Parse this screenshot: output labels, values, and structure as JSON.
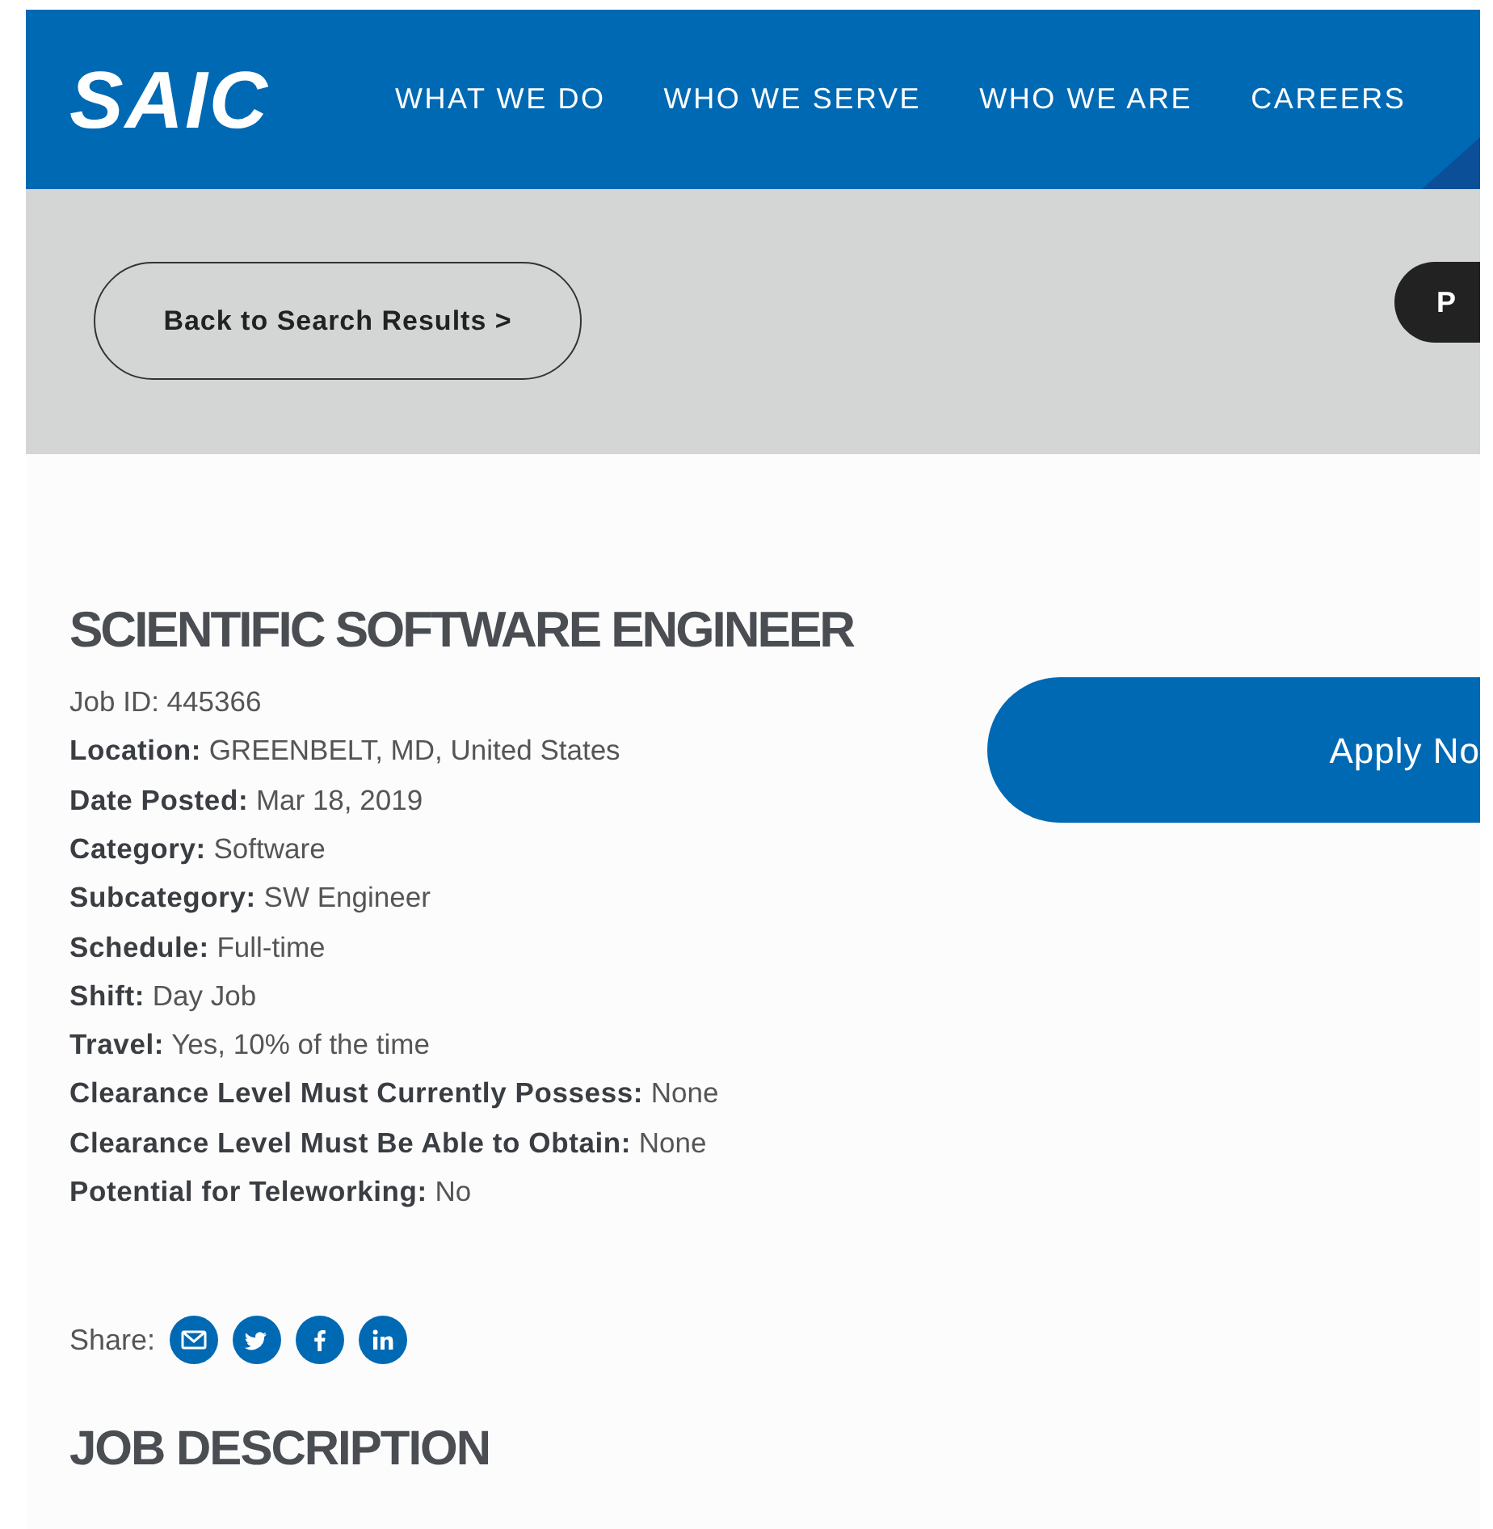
{
  "header": {
    "logo": "SAIC",
    "nav": [
      {
        "label": "WHAT WE DO"
      },
      {
        "label": "WHO WE SERVE"
      },
      {
        "label": "WHO WE ARE"
      },
      {
        "label": "CAREERS"
      }
    ]
  },
  "toolbar": {
    "back_button": "Back to Search Results >",
    "dark_button": "P"
  },
  "job": {
    "title": "SCIENTIFIC SOFTWARE ENGINEER",
    "details": [
      "Job ID: 445366",
      "**Location:** GREENBELT, MD, United States",
      "**Date Posted:** Mar 18, 2019",
      "**Category:** Software",
      "**Subcategory:** SW Engineer",
      "**Schedule:** Full-time",
      "**Shift:** Day Job",
      "**Travel:** Yes, 10% of the time",
      "**Clearance Level Must Currently Possess:** None",
      "**Clearance Level Must Be Able to Obtain:** None",
      "**Potential for Teleworking:** No"
    ],
    "apply_button": "Apply No",
    "share": {
      "label": "Share:",
      "icons": [
        {
          "kind": "email"
        },
        {
          "kind": "twitter"
        },
        {
          "kind": "facebook"
        },
        {
          "kind": "linkedin"
        }
      ]
    },
    "section_heading": "JOB DESCRIPTION"
  }
}
